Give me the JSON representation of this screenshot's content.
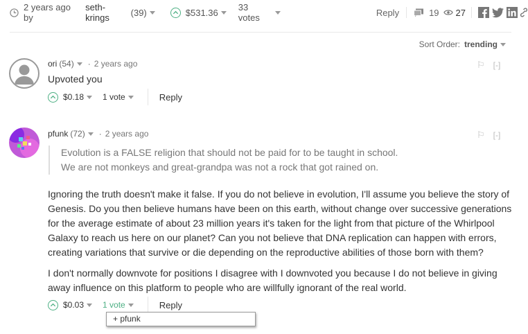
{
  "post": {
    "age": "2 years ago by",
    "author": "seth-krings",
    "author_rep": "(39)",
    "payout": "$531.36",
    "votes": "33 votes",
    "reply": "Reply",
    "comments_count": "19",
    "views_count": "27"
  },
  "sort": {
    "label": "Sort Order:",
    "value": "trending"
  },
  "comments": [
    {
      "author": "ori",
      "rep": "(54)",
      "age": "2 years ago",
      "flag": "⚐",
      "collapse": "[-]",
      "body": "Upvoted you",
      "payout": "$0.18",
      "votes": "1 vote",
      "reply": "Reply"
    },
    {
      "author": "pfunk",
      "rep": "(72)",
      "age": "2 years ago",
      "flag": "⚐",
      "collapse": "[-]",
      "quote": [
        "Evolution is a FALSE religion that should not be paid for to be taught in school.",
        "We are not monkeys and great-grandpa was not a rock that got rained on."
      ],
      "paragraphs": [
        "Ignoring the truth doesn't make it false. If you do not believe in evolution, I'll assume you believe the story of Genesis. Do you then believe humans have been on this earth, without change over successive generations for the average estimate of about 23 million years it's taken for the light from that picture of the Whirlpool Galaxy to reach us here on our planet? Can you not believe that DNA replication can happen with errors, creating variations that survive or die depending on the reproductive abilities of those born with them?",
        "I don't normally downvote for positions I disagree with I downvoted you because I do not believe in giving away influence on this platform to people who are willfully ignorant of the real world."
      ],
      "payout": "$0.03",
      "votes": "1 vote",
      "reply": "Reply",
      "voters": [
        "+ pfunk"
      ]
    }
  ],
  "colors": {
    "accent_green": "#4caf83",
    "muted": "#999999"
  }
}
